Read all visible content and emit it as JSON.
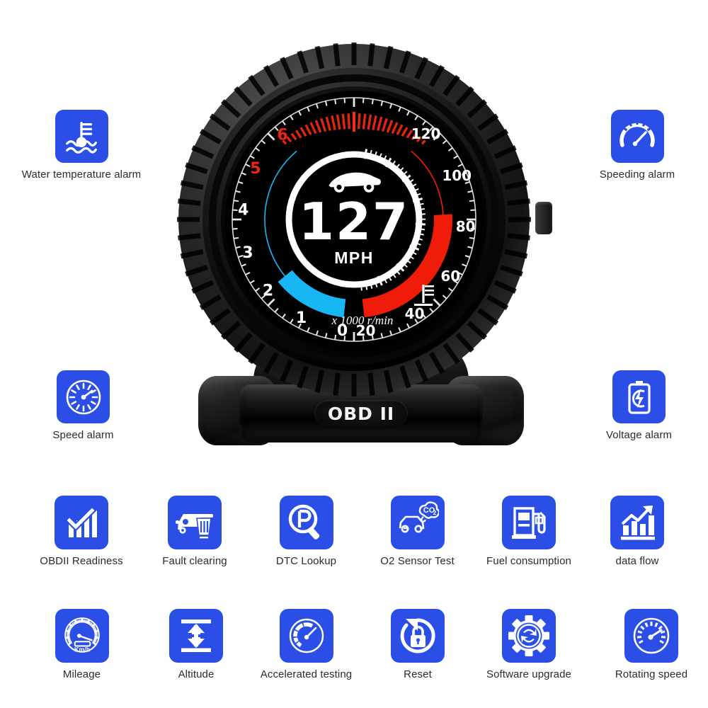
{
  "product": {
    "brand_badge": "OBD II",
    "display": {
      "speed_value": "127",
      "speed_unit": "MPH",
      "rpm_unit_label": "x 1000 r/min",
      "rpm_ticks": [
        "0",
        "1",
        "2",
        "3",
        "4",
        "5",
        "6"
      ],
      "rpm_redline_ticks": [
        "5",
        "6"
      ],
      "rpm_current": 2.0,
      "temp_ticks": [
        "20",
        "40",
        "60",
        "80",
        "100",
        "120"
      ],
      "temp_current": 85,
      "car_icon": "sports-car-icon",
      "coolant_icon": "coolant-temp-icon",
      "colors": {
        "rpm_bar": "#17b9f3",
        "temp_bar": "#f01c0a",
        "redline_text": "#ef2415",
        "dial_text": "#ffffff",
        "screen_bg": "#000000"
      }
    }
  },
  "theme": {
    "tile_blue": "#2a4ee6",
    "caption_color": "#2b2b2b",
    "page_bg": "#ffffff"
  },
  "features": {
    "top_left": [
      {
        "label": "Water temperature alarm",
        "icon": "water-temperature-icon"
      },
      {
        "label": "Speed alarm",
        "icon": "speedometer-dial-icon"
      }
    ],
    "top_right": [
      {
        "label": "Speeding alarm",
        "icon": "speeding-gauge-icon"
      },
      {
        "label": "Voltage alarm",
        "icon": "battery-bolt-icon"
      }
    ],
    "row_middle": [
      {
        "label": "OBDII Readiness",
        "icon": "check-bars-icon"
      },
      {
        "label": "Fault clearing",
        "icon": "car-trash-icon"
      },
      {
        "label": "DTC Lookup",
        "icon": "magnifier-p-icon"
      },
      {
        "label": "O2 Sensor Test",
        "icon": "car-co2-icon"
      },
      {
        "label": "Fuel consumption",
        "icon": "fuel-pump-icon"
      },
      {
        "label": "data flow",
        "icon": "bar-chart-arrow-icon"
      }
    ],
    "row_bottom": [
      {
        "label": "Mileage",
        "icon": "mileage-gauge-icon",
        "sub": "Km/h"
      },
      {
        "label": "Altitude",
        "icon": "vertical-arrows-icon"
      },
      {
        "label": "Accelerated testing",
        "icon": "acceleration-gauge-icon"
      },
      {
        "label": "Reset",
        "icon": "reset-lock-icon"
      },
      {
        "label": "Software upgrade",
        "icon": "gear-refresh-icon"
      },
      {
        "label": "Rotating speed",
        "icon": "tachometer-icon"
      }
    ]
  }
}
